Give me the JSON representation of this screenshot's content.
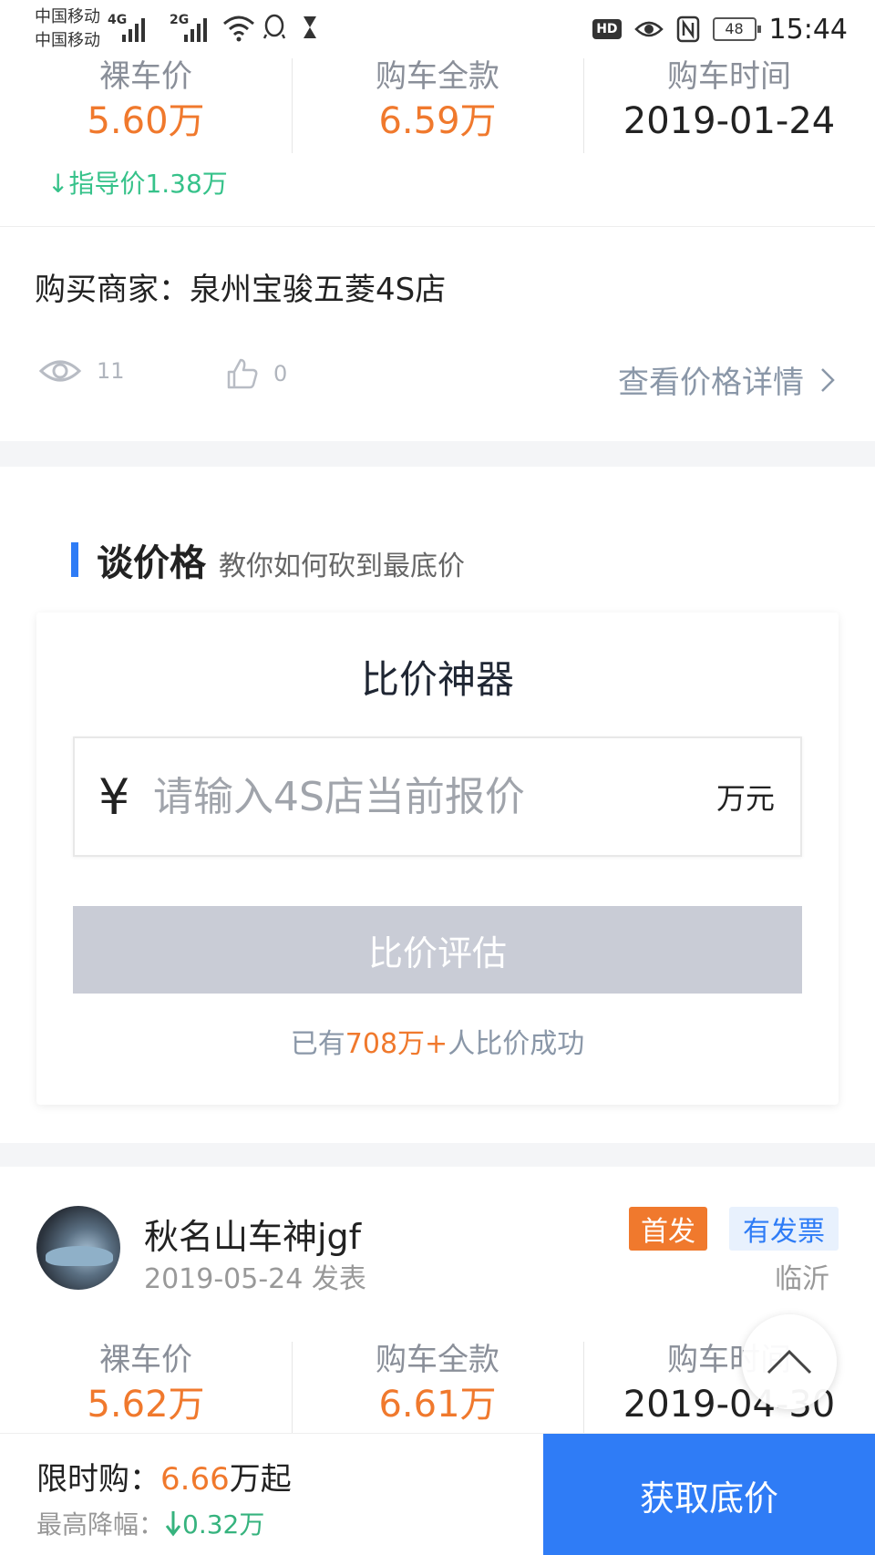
{
  "status_bar": {
    "carrier1": "中国移动",
    "carrier2": "中国移动",
    "net1": "4G",
    "net2": "2G",
    "hd": "HD",
    "battery": "48",
    "time": "15:44"
  },
  "top_prices": {
    "bare_label": "裸车价",
    "bare_value": "5.60万",
    "full_label": "购车全款",
    "full_value": "6.59万",
    "date_label": "购车时间",
    "date_value": "2019-01-24",
    "guide_text": "↓指导价1.38万"
  },
  "dealer": "购买商家：泉州宝骏五菱4S店",
  "stats": {
    "views": "11",
    "likes": "0",
    "details_link": "查看价格详情"
  },
  "haggle": {
    "title": "谈价格",
    "subtitle": "教你如何砍到最底价",
    "card_title": "比价神器",
    "currency": "¥",
    "input_placeholder": "请输入4S店当前报价",
    "unit": "万元",
    "button": "比价评估",
    "success_prefix": "已有",
    "success_count": "708万+",
    "success_suffix": "人比价成功"
  },
  "post": {
    "username": "秋名山车神jgf",
    "posted": "2019-05-24 发表",
    "tag_first": "首发",
    "tag_invoice": "有发票",
    "city": "临沂",
    "bare_label": "裸车价",
    "bare_value": "5.62万",
    "full_label": "购车全款",
    "full_value": "6.61万",
    "date_label": "购车时间",
    "date_value": "2019-04-30"
  },
  "bottom_bar": {
    "flash_label": "限时购：",
    "flash_price": "6.66",
    "flash_suffix": "万起",
    "drop_label": "最高降幅：",
    "drop_value": "0.32万",
    "get_price_button": "获取底价"
  },
  "colors": {
    "accent_blue": "#2f7cf6",
    "price_orange": "#f0792d",
    "green": "#36c28a"
  }
}
